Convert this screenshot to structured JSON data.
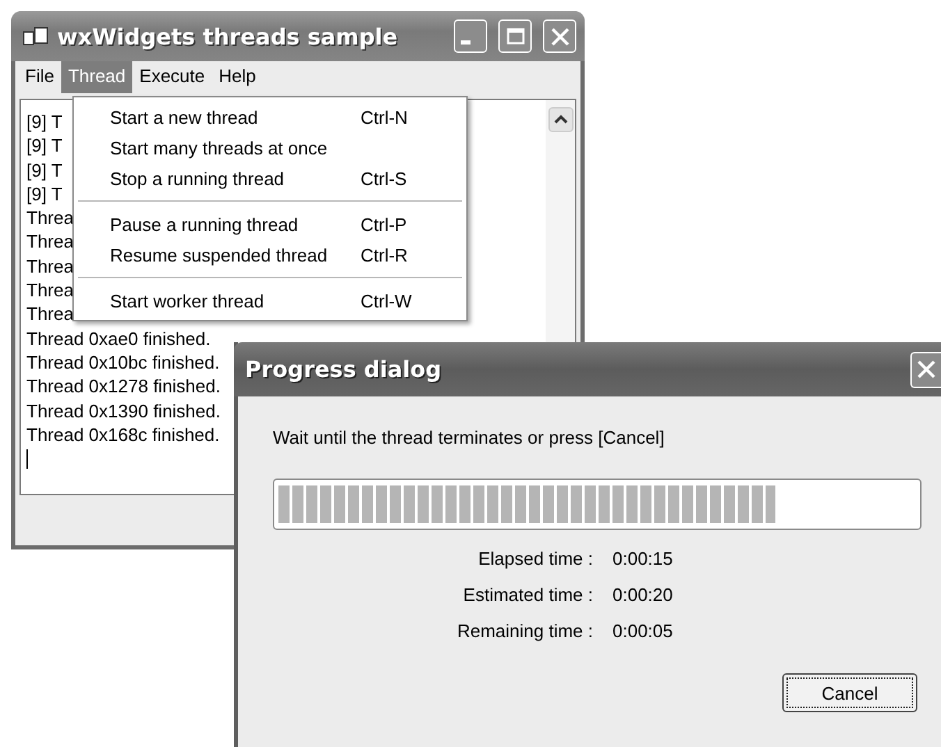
{
  "main_window": {
    "title": "wxWidgets threads sample",
    "menu_bar": [
      {
        "label": "File",
        "selected": false
      },
      {
        "label": "Thread",
        "selected": true
      },
      {
        "label": "Execute",
        "selected": false
      },
      {
        "label": "Help",
        "selected": false
      }
    ],
    "log": [
      "[9] T",
      "[9] T",
      "[9] T",
      "[9] T",
      "Threa",
      "Threa",
      "Threa",
      "Threa",
      "Threa",
      "Thread 0xae0 finished.",
      "Thread 0x10bc finished.",
      "Thread 0x1278 finished.",
      "Thread 0x1390 finished.",
      "Thread 0x168c finished."
    ]
  },
  "thread_menu": [
    {
      "kind": "item",
      "label": "Start a new thread",
      "shortcut": "Ctrl-N"
    },
    {
      "kind": "item",
      "label": "Start many threads at once"
    },
    {
      "kind": "item",
      "label": "Stop a running thread",
      "shortcut": "Ctrl-S"
    },
    {
      "kind": "separator"
    },
    {
      "kind": "item",
      "label": "Pause a running thread",
      "shortcut": "Ctrl-P"
    },
    {
      "kind": "item",
      "label": "Resume suspended thread",
      "shortcut": "Ctrl-R"
    },
    {
      "kind": "separator"
    },
    {
      "kind": "item",
      "label": "Start worker thread",
      "shortcut": "Ctrl-W"
    }
  ],
  "progress_dialog": {
    "title": "Progress dialog",
    "message": "Wait until the thread terminates or press [Cancel]",
    "progress": {
      "level": 0.78
    },
    "times": [
      {
        "label": "Elapsed time :",
        "value": "0:00:15"
      },
      {
        "label": "Estimated time :",
        "value": "0:00:20"
      },
      {
        "label": "Remaining time :",
        "value": "0:00:05"
      }
    ],
    "buttons": [
      {
        "label": "Cancel",
        "focused": true
      }
    ]
  }
}
